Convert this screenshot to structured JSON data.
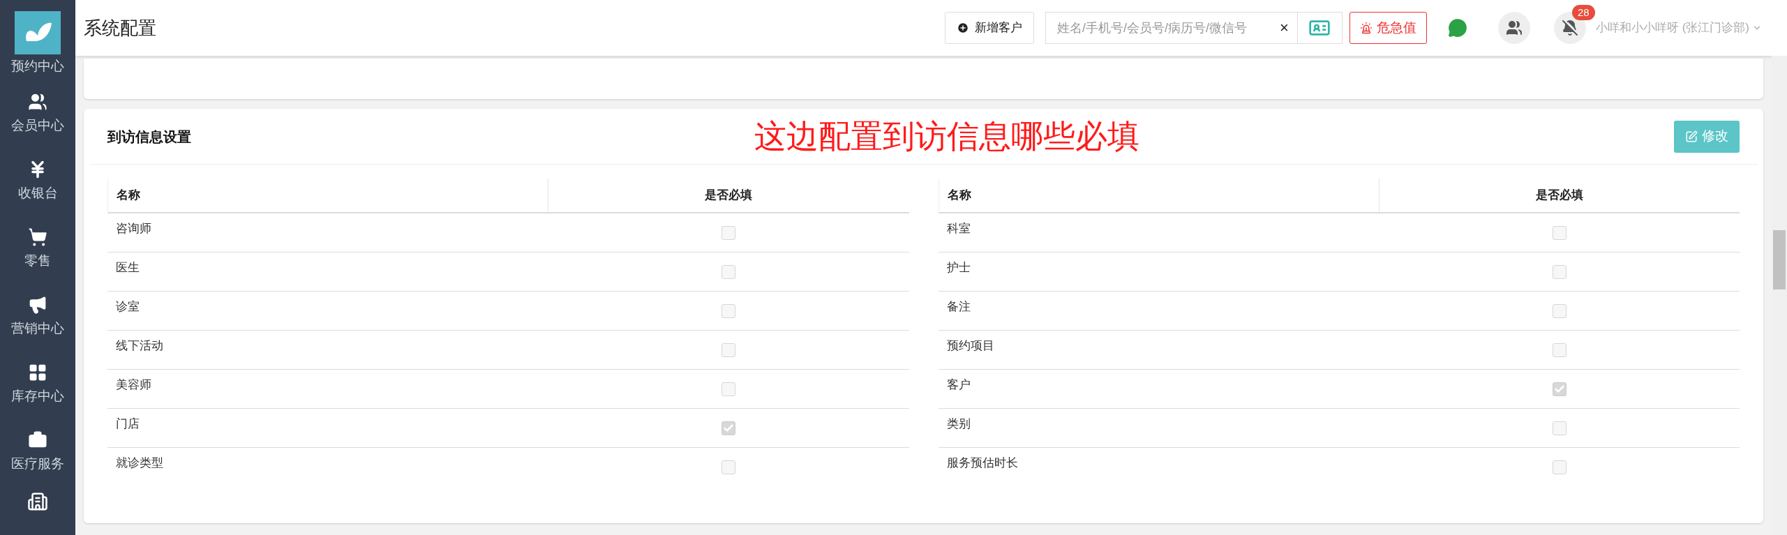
{
  "sidebar": {
    "items": [
      {
        "label": "预约中心"
      },
      {
        "label": "会员中心"
      },
      {
        "label": "收银台"
      },
      {
        "label": "零售"
      },
      {
        "label": "营销中心"
      },
      {
        "label": "库存中心"
      },
      {
        "label": "医疗服务"
      }
    ]
  },
  "header": {
    "title": "系统配置",
    "new_customer_button": "新增客户",
    "search": {
      "placeholder": "姓名/手机号/会员号/病历号/微信号"
    },
    "clear_button": "×",
    "critical_button": "危急值",
    "notification_count": "28",
    "user": "小咩和小小咩呀 (张江门诊部)"
  },
  "section": {
    "title": "到访信息设置",
    "annotation": "这边配置到访信息哪些必填",
    "edit_button": "修改",
    "tables": [
      {
        "columns": [
          "名称",
          "是否必填"
        ],
        "rows": [
          {
            "name": "咨询师",
            "checked": false
          },
          {
            "name": "医生",
            "checked": false
          },
          {
            "name": "诊室",
            "checked": false
          },
          {
            "name": "线下活动",
            "checked": false
          },
          {
            "name": "美容师",
            "checked": false
          },
          {
            "name": "门店",
            "checked": true
          },
          {
            "name": "就诊类型",
            "checked": false
          }
        ]
      },
      {
        "columns": [
          "名称",
          "是否必填"
        ],
        "rows": [
          {
            "name": "科室",
            "checked": false
          },
          {
            "name": "护士",
            "checked": false
          },
          {
            "name": "备注",
            "checked": false
          },
          {
            "name": "预约项目",
            "checked": false
          },
          {
            "name": "客户",
            "checked": true
          },
          {
            "name": "类别",
            "checked": false
          },
          {
            "name": "服务预估时长",
            "checked": false
          }
        ]
      }
    ]
  }
}
